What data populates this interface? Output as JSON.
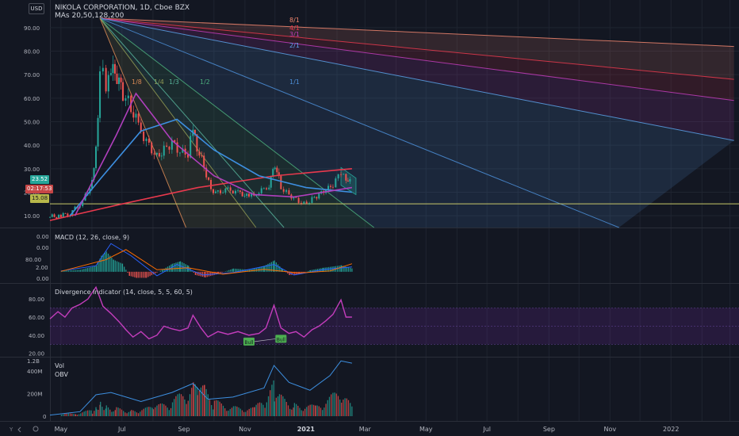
{
  "header": {
    "currency_button": "USD",
    "title": "NIKOLA CORPORATION, 1D, Cboe BZX",
    "ma_legend": "MAs 20,50,128,200"
  },
  "price_tags": {
    "last_price": "23.52",
    "countdown": "02:17:53",
    "level": "15.08"
  },
  "colors": {
    "background": "#131722",
    "grid": "#1f2430",
    "candle_up": "#26a69a",
    "candle_down": "#ef5350",
    "ma_red": "#e8394d",
    "ma_blue": "#3d8fe0",
    "ma_purple": "#b03fbd",
    "divergence": "#c33dbc"
  },
  "time_axis": {
    "labels": [
      "May",
      "Jul",
      "Sep",
      "Nov",
      "2021",
      "Mar",
      "May",
      "Jul",
      "Sep",
      "Nov",
      "2022"
    ]
  },
  "axis_icons": [
    "Y",
    "scroll-left",
    "settings"
  ],
  "chart_data": [
    {
      "type": "candlestick",
      "title": "NIKOLA CORPORATION, 1D, Cboe BZX",
      "ylim": [
        5,
        95
      ],
      "y_ticks": [
        10,
        20,
        30,
        40,
        50,
        60,
        70,
        80,
        90
      ],
      "tick_labels": [
        "10.00",
        "20.00",
        "30.00",
        "40.00",
        "50.00",
        "60.00",
        "70.00",
        "80.00",
        "90.00"
      ],
      "series_close": [
        {
          "date": "2020-04-20",
          "v": 9.5
        },
        {
          "date": "2020-05-01",
          "v": 10
        },
        {
          "date": "2020-05-10",
          "v": 11
        },
        {
          "date": "2020-05-20",
          "v": 15
        },
        {
          "date": "2020-05-28",
          "v": 20
        },
        {
          "date": "2020-06-01",
          "v": 25
        },
        {
          "date": "2020-06-05",
          "v": 38
        },
        {
          "date": "2020-06-09",
          "v": 68
        },
        {
          "date": "2020-06-12",
          "v": 70
        },
        {
          "date": "2020-06-15",
          "v": 62
        },
        {
          "date": "2020-06-20",
          "v": 72
        },
        {
          "date": "2020-06-26",
          "v": 69
        },
        {
          "date": "2020-07-02",
          "v": 62
        },
        {
          "date": "2020-07-10",
          "v": 56
        },
        {
          "date": "2020-07-20",
          "v": 46
        },
        {
          "date": "2020-07-28",
          "v": 40
        },
        {
          "date": "2020-08-05",
          "v": 35
        },
        {
          "date": "2020-08-12",
          "v": 38
        },
        {
          "date": "2020-08-20",
          "v": 41
        },
        {
          "date": "2020-08-28",
          "v": 37
        },
        {
          "date": "2020-09-05",
          "v": 36
        },
        {
          "date": "2020-09-10",
          "v": 49
        },
        {
          "date": "2020-09-14",
          "v": 39
        },
        {
          "date": "2020-09-21",
          "v": 31
        },
        {
          "date": "2020-09-28",
          "v": 21
        },
        {
          "date": "2020-10-05",
          "v": 20
        },
        {
          "date": "2020-10-15",
          "v": 21
        },
        {
          "date": "2020-10-25",
          "v": 20
        },
        {
          "date": "2020-11-05",
          "v": 18
        },
        {
          "date": "2020-11-15",
          "v": 20
        },
        {
          "date": "2020-11-25",
          "v": 23
        },
        {
          "date": "2020-12-01",
          "v": 32
        },
        {
          "date": "2020-12-07",
          "v": 22
        },
        {
          "date": "2020-12-15",
          "v": 19
        },
        {
          "date": "2020-12-22",
          "v": 17
        },
        {
          "date": "2020-12-30",
          "v": 15
        },
        {
          "date": "2021-01-07",
          "v": 17
        },
        {
          "date": "2021-01-14",
          "v": 19
        },
        {
          "date": "2021-01-21",
          "v": 21
        },
        {
          "date": "2021-01-28",
          "v": 23
        },
        {
          "date": "2021-02-05",
          "v": 29
        },
        {
          "date": "2021-02-10",
          "v": 26
        },
        {
          "date": "2021-02-16",
          "v": 23.52
        }
      ],
      "moving_averages": [
        {
          "name": "MA 200",
          "color": "#e8394d",
          "points": [
            {
              "date": "2020-04-20",
              "v": 8
            },
            {
              "date": "2020-07-01",
              "v": 15
            },
            {
              "date": "2020-09-15",
              "v": 22
            },
            {
              "date": "2020-12-01",
              "v": 27
            },
            {
              "date": "2021-02-16",
              "v": 30
            }
          ]
        },
        {
          "name": "MA 128",
          "color": "#3d8fe0",
          "points": [
            {
              "date": "2020-05-10",
              "v": 10
            },
            {
              "date": "2020-06-10",
              "v": 26
            },
            {
              "date": "2020-07-20",
              "v": 46
            },
            {
              "date": "2020-08-25",
              "v": 51
            },
            {
              "date": "2020-10-01",
              "v": 38
            },
            {
              "date": "2020-11-15",
              "v": 27
            },
            {
              "date": "2021-01-01",
              "v": 22
            },
            {
              "date": "2021-02-16",
              "v": 20
            }
          ]
        },
        {
          "name": "MA 50",
          "color": "#b03fbd",
          "points": [
            {
              "date": "2020-05-15",
              "v": 10
            },
            {
              "date": "2020-06-25",
              "v": 44
            },
            {
              "date": "2020-07-15",
              "v": 62
            },
            {
              "date": "2020-08-20",
              "v": 42
            },
            {
              "date": "2020-10-01",
              "v": 27
            },
            {
              "date": "2020-11-10",
              "v": 19
            },
            {
              "date": "2020-12-20",
              "v": 18
            },
            {
              "date": "2021-02-16",
              "v": 22
            }
          ]
        }
      ],
      "horizontal_level": 15.08,
      "fan_origin": {
        "date": "2020-06-09",
        "v": 93.99
      },
      "fan_labels": [
        "8/1",
        "4/1",
        "3/1",
        "2/1",
        "1/1",
        "1/2",
        "1/3",
        "1/4",
        "1/8"
      ],
      "fan_lines": [
        {
          "label": "8/1",
          "end": {
            "date": "2022-03-05",
            "v": 82
          },
          "color": "#f0866e"
        },
        {
          "label": "4/1",
          "end": {
            "date": "2022-03-05",
            "v": 68
          },
          "color": "#e8394d"
        },
        {
          "label": "3/1",
          "end": {
            "date": "2022-03-05",
            "v": 59
          },
          "color": "#c23dbb"
        },
        {
          "label": "2/1",
          "end": {
            "date": "2022-03-05",
            "v": 42
          },
          "color": "#5aa2e8"
        },
        {
          "label": "1/1",
          "end": {
            "date": "2021-11-10",
            "v": 5
          },
          "color": "#4c8fd8"
        },
        {
          "label": "1/2",
          "end": {
            "date": "2021-03-10",
            "v": 5
          },
          "color": "#4cae7c"
        },
        {
          "label": "1/3",
          "end": {
            "date": "2020-12-10",
            "v": 5
          },
          "color": "#57b39a"
        },
        {
          "label": "1/4",
          "end": {
            "date": "2020-11-12",
            "v": 5
          },
          "color": "#8f9a54"
        },
        {
          "label": "1/8",
          "end": {
            "date": "2020-09-03",
            "v": 5
          },
          "color": "#d98a55"
        }
      ]
    },
    {
      "type": "bar",
      "title": "MACD (12, 26, close, 9)",
      "ylim": [
        -20,
        100
      ],
      "tick_labels": [
        "0.00",
        "2.00",
        "80.00",
        "0.00",
        "0.00"
      ],
      "histogram": [
        {
          "date": "2020-05-01",
          "v": 2
        },
        {
          "date": "2020-05-20",
          "v": 5
        },
        {
          "date": "2020-06-05",
          "v": 15
        },
        {
          "date": "2020-06-10",
          "v": 40
        },
        {
          "date": "2020-06-15",
          "v": 50
        },
        {
          "date": "2020-06-22",
          "v": 30
        },
        {
          "date": "2020-07-01",
          "v": 20
        },
        {
          "date": "2020-07-08",
          "v": -10
        },
        {
          "date": "2020-07-15",
          "v": -15
        },
        {
          "date": "2020-07-25",
          "v": -15
        },
        {
          "date": "2020-08-10",
          "v": 5
        },
        {
          "date": "2020-08-20",
          "v": 20
        },
        {
          "date": "2020-08-28",
          "v": 26
        },
        {
          "date": "2020-09-05",
          "v": 15
        },
        {
          "date": "2020-09-12",
          "v": -8
        },
        {
          "date": "2020-09-22",
          "v": -14
        },
        {
          "date": "2020-10-05",
          "v": -5
        },
        {
          "date": "2020-10-20",
          "v": 8
        },
        {
          "date": "2020-11-05",
          "v": 5
        },
        {
          "date": "2020-11-20",
          "v": 15
        },
        {
          "date": "2020-11-30",
          "v": 28
        },
        {
          "date": "2020-12-08",
          "v": 6
        },
        {
          "date": "2020-12-15",
          "v": -8
        },
        {
          "date": "2020-12-25",
          "v": -6
        },
        {
          "date": "2021-01-05",
          "v": 4
        },
        {
          "date": "2021-01-18",
          "v": 10
        },
        {
          "date": "2021-02-05",
          "v": 16
        },
        {
          "date": "2021-02-16",
          "v": 8
        }
      ],
      "macd_line": [
        {
          "date": "2020-05-01",
          "v": 2
        },
        {
          "date": "2020-06-05",
          "v": 15
        },
        {
          "date": "2020-06-20",
          "v": 70
        },
        {
          "date": "2020-07-10",
          "v": 40
        },
        {
          "date": "2020-08-05",
          "v": -10
        },
        {
          "date": "2020-08-25",
          "v": 18
        },
        {
          "date": "2020-09-20",
          "v": -8
        },
        {
          "date": "2020-10-20",
          "v": -2
        },
        {
          "date": "2020-11-30",
          "v": 18
        },
        {
          "date": "2020-12-20",
          "v": -8
        },
        {
          "date": "2021-01-20",
          "v": 6
        },
        {
          "date": "2021-02-16",
          "v": 12
        }
      ],
      "signal_line": [
        {
          "date": "2020-05-01",
          "v": 1
        },
        {
          "date": "2020-06-15",
          "v": 30
        },
        {
          "date": "2020-07-05",
          "v": 55
        },
        {
          "date": "2020-08-05",
          "v": 5
        },
        {
          "date": "2020-09-05",
          "v": 10
        },
        {
          "date": "2020-10-10",
          "v": -6
        },
        {
          "date": "2020-11-20",
          "v": 6
        },
        {
          "date": "2020-12-25",
          "v": -3
        },
        {
          "date": "2021-01-25",
          "v": 2
        },
        {
          "date": "2021-02-16",
          "v": 20
        }
      ]
    },
    {
      "type": "line",
      "title": "Divergence Indicator (14, close, 5, 5, 60, 5)",
      "ylim": [
        18,
        95
      ],
      "y_ticks": [
        20,
        40,
        60,
        80
      ],
      "tick_labels": [
        "20.00",
        "40.00",
        "60.00",
        "80.00"
      ],
      "band": [
        30,
        70
      ],
      "annotations": [
        {
          "text": "Bull",
          "date": "2020-11-05",
          "v": 33
        },
        {
          "text": "Bull",
          "date": "2020-12-07",
          "v": 36
        }
      ],
      "values": [
        {
          "date": "2020-04-20",
          "v": 58
        },
        {
          "date": "2020-04-28",
          "v": 66
        },
        {
          "date": "2020-05-05",
          "v": 60
        },
        {
          "date": "2020-05-12",
          "v": 70
        },
        {
          "date": "2020-05-20",
          "v": 74
        },
        {
          "date": "2020-05-28",
          "v": 80
        },
        {
          "date": "2020-06-05",
          "v": 93
        },
        {
          "date": "2020-06-12",
          "v": 72
        },
        {
          "date": "2020-06-20",
          "v": 64
        },
        {
          "date": "2020-06-28",
          "v": 55
        },
        {
          "date": "2020-07-05",
          "v": 46
        },
        {
          "date": "2020-07-12",
          "v": 38
        },
        {
          "date": "2020-07-20",
          "v": 44
        },
        {
          "date": "2020-07-28",
          "v": 36
        },
        {
          "date": "2020-08-05",
          "v": 40
        },
        {
          "date": "2020-08-12",
          "v": 50
        },
        {
          "date": "2020-08-20",
          "v": 47
        },
        {
          "date": "2020-08-28",
          "v": 45
        },
        {
          "date": "2020-09-05",
          "v": 48
        },
        {
          "date": "2020-09-10",
          "v": 62
        },
        {
          "date": "2020-09-18",
          "v": 48
        },
        {
          "date": "2020-09-25",
          "v": 38
        },
        {
          "date": "2020-10-05",
          "v": 44
        },
        {
          "date": "2020-10-15",
          "v": 41
        },
        {
          "date": "2020-10-25",
          "v": 44
        },
        {
          "date": "2020-11-05",
          "v": 40
        },
        {
          "date": "2020-11-15",
          "v": 42
        },
        {
          "date": "2020-11-22",
          "v": 48
        },
        {
          "date": "2020-11-30",
          "v": 73
        },
        {
          "date": "2020-12-07",
          "v": 48
        },
        {
          "date": "2020-12-15",
          "v": 42
        },
        {
          "date": "2020-12-22",
          "v": 44
        },
        {
          "date": "2020-12-30",
          "v": 38
        },
        {
          "date": "2021-01-07",
          "v": 46
        },
        {
          "date": "2021-01-14",
          "v": 50
        },
        {
          "date": "2021-01-21",
          "v": 56
        },
        {
          "date": "2021-01-28",
          "v": 63
        },
        {
          "date": "2021-02-05",
          "v": 79
        },
        {
          "date": "2021-02-10",
          "v": 60
        },
        {
          "date": "2021-02-16",
          "v": 60
        }
      ]
    },
    {
      "type": "bar",
      "title": "Vol",
      "subtitle": "OBV",
      "ylim": [
        0,
        1200
      ],
      "y_ticks": [
        0,
        200,
        400,
        1200
      ],
      "tick_labels": [
        "0",
        "200M",
        "400M",
        "1.2B"
      ],
      "volume_millions": [
        {
          "date": "2020-05-01",
          "v": 20
        },
        {
          "date": "2020-05-15",
          "v": 30
        },
        {
          "date": "2020-06-01",
          "v": 60
        },
        {
          "date": "2020-06-05",
          "v": 120
        },
        {
          "date": "2020-06-09",
          "v": 190
        },
        {
          "date": "2020-06-15",
          "v": 110
        },
        {
          "date": "2020-06-25",
          "v": 80
        },
        {
          "date": "2020-07-10",
          "v": 60
        },
        {
          "date": "2020-08-01",
          "v": 90
        },
        {
          "date": "2020-08-20",
          "v": 150
        },
        {
          "date": "2020-09-10",
          "v": 330
        },
        {
          "date": "2020-09-14",
          "v": 250
        },
        {
          "date": "2020-09-21",
          "v": 280
        },
        {
          "date": "2020-10-01",
          "v": 150
        },
        {
          "date": "2020-10-20",
          "v": 90
        },
        {
          "date": "2020-11-10",
          "v": 80
        },
        {
          "date": "2020-11-30",
          "v": 330
        },
        {
          "date": "2020-12-05",
          "v": 200
        },
        {
          "date": "2020-12-20",
          "v": 120
        },
        {
          "date": "2021-01-10",
          "v": 100
        },
        {
          "date": "2021-02-05",
          "v": 260
        },
        {
          "date": "2021-02-16",
          "v": 80
        }
      ],
      "obv_millions": [
        {
          "date": "2020-04-20",
          "v": 10
        },
        {
          "date": "2020-05-20",
          "v": 40
        },
        {
          "date": "2020-06-05",
          "v": 190
        },
        {
          "date": "2020-06-20",
          "v": 210
        },
        {
          "date": "2020-07-20",
          "v": 130
        },
        {
          "date": "2020-08-20",
          "v": 210
        },
        {
          "date": "2020-09-10",
          "v": 290
        },
        {
          "date": "2020-09-25",
          "v": 150
        },
        {
          "date": "2020-10-20",
          "v": 170
        },
        {
          "date": "2020-11-20",
          "v": 250
        },
        {
          "date": "2020-11-30",
          "v": 450
        },
        {
          "date": "2020-12-15",
          "v": 300
        },
        {
          "date": "2021-01-05",
          "v": 230
        },
        {
          "date": "2021-01-25",
          "v": 360
        },
        {
          "date": "2021-02-05",
          "v": 490
        },
        {
          "date": "2021-02-16",
          "v": 470
        }
      ]
    }
  ]
}
